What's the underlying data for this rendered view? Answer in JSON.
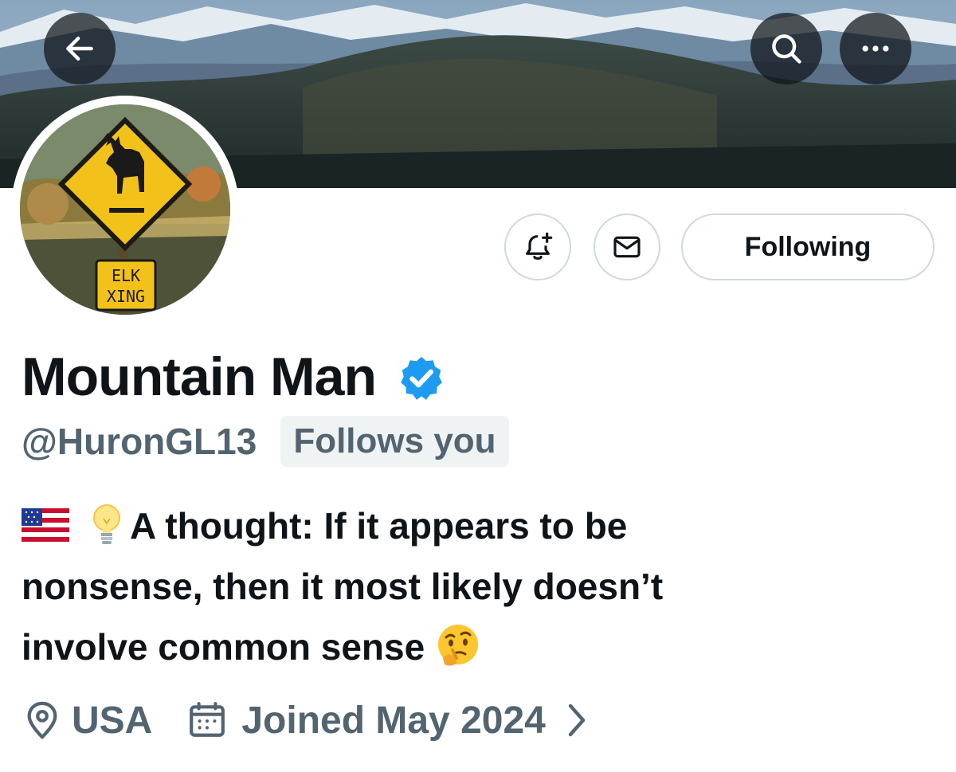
{
  "header": {
    "back_icon": "arrow-left-icon",
    "search_icon": "search-icon",
    "more_icon": "more-horizontal-icon"
  },
  "profile": {
    "avatar_sign_text_1": "ELK",
    "avatar_sign_text_2": "XING",
    "display_name": "Mountain Man",
    "verified": true,
    "handle": "@HuronGL13",
    "follows_you_label": "Follows you",
    "bio_line_1": "A thought: If it appears to be",
    "bio_line_2": "nonsense, then it most likely doesn’t",
    "bio_line_3": "involve common sense",
    "bio_emojis": [
      "flag-usa-icon",
      "light-bulb-icon",
      "thinking-face-icon"
    ],
    "location": "USA",
    "joined": "Joined May 2024"
  },
  "actions": {
    "notify_icon": "bell-plus-icon",
    "message_icon": "envelope-icon",
    "following_label": "Following"
  },
  "colors": {
    "verified_blue": "#1d9bf0",
    "secondary_text": "#536471",
    "primary_text": "#0f1419",
    "border": "#cfd9de"
  }
}
